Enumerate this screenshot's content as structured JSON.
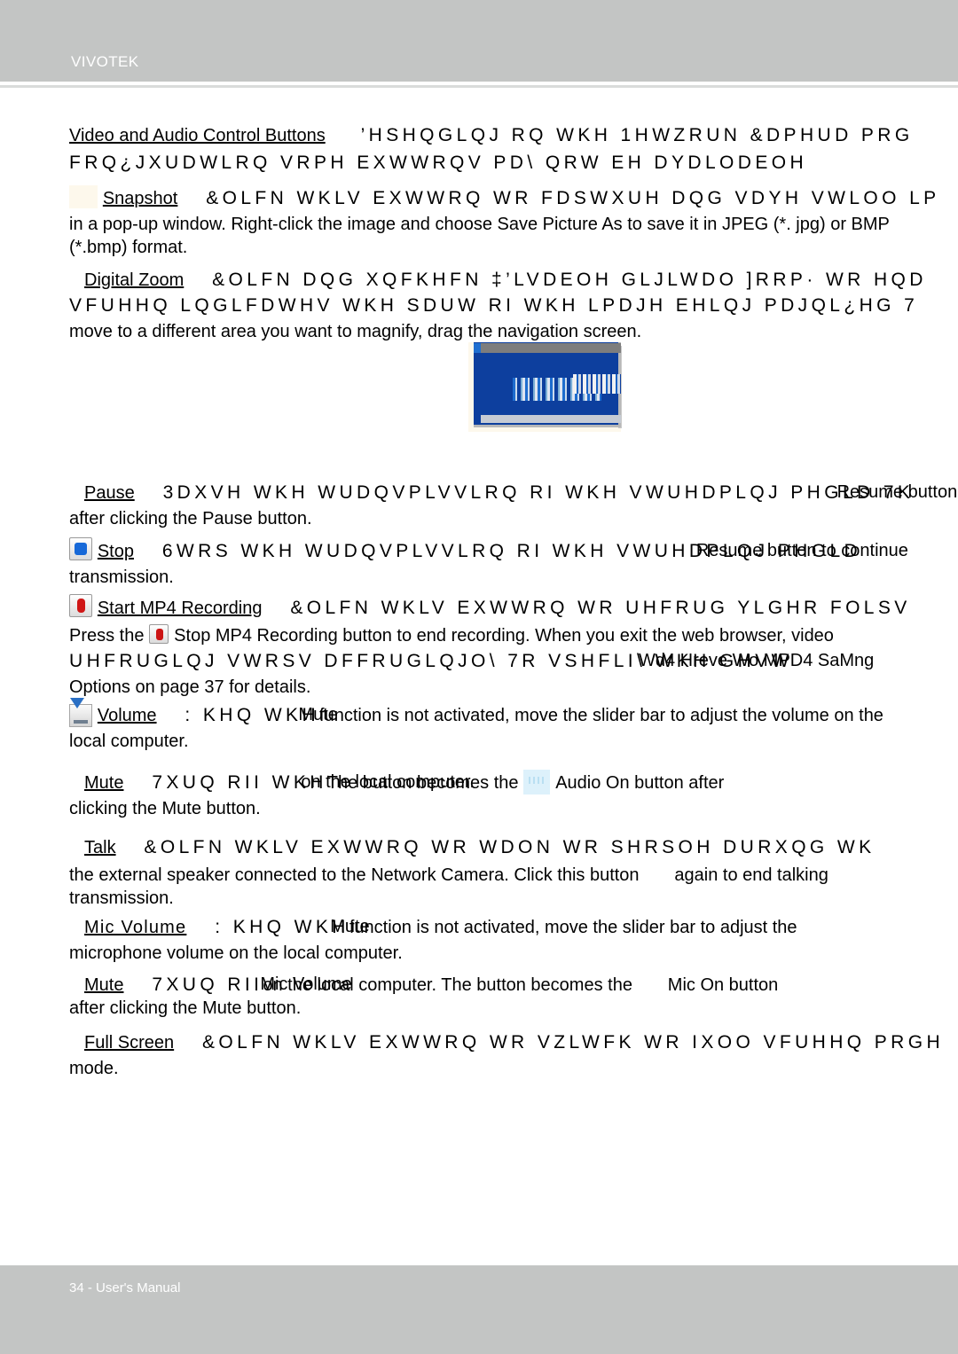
{
  "header": {
    "brand": "VIVOTEK"
  },
  "footer": {
    "page_label": "34 - User's Manual"
  },
  "colors": {
    "header_band": "#c3c5c4",
    "footer_band": "#c3c5c4",
    "page_background": "#ffffff",
    "body_text": "#000000",
    "brand_text": "#ffffff",
    "figure_window_blue": "#0d3f9e",
    "stop_icon_blue": "#1769d8",
    "record_icon_red": "#d01717",
    "audio_on_icon_blue": "#ddf1fb"
  },
  "sections": {
    "intro": {
      "label": "Video and Audio Control Buttons",
      "encoded_line1": "’HSHQGLQJ RQ WKH 1HWZRUN &DPHUD PRG",
      "encoded_line2": "FRQ¿JXUDWLRQ  VRPH EXWWRQV PD\\ QRW EH DYDLODEOH"
    },
    "snapshot": {
      "icon": "snapshot-icon",
      "label": "Snapshot",
      "encoded": "&OLFN WKLV EXWWRQ WR FDSWXUH DQG VDYH VWLOO LP",
      "plain_line2": "in a pop-up window. Right-click the image and choose Save Picture As to save it in JPEG (*. jpg) or BMP",
      "plain_line3": "(*.bmp) format."
    },
    "digital_zoom": {
      "label": "Digital Zoom",
      "encoded_line1": "&OLFN DQG XQFKHFN ‡’LVDEOH GLJLWDO ]RRP· WR HQD",
      "encoded_line2": "VFUHHQ LQGLFDWHV WKH SDUW RI WKH LPDJH EHLQJ PDJQL¿HG  7",
      "plain_line3": "move to a different area you want to magnify, drag the navigation screen."
    },
    "pause": {
      "label": "Pause",
      "encoded": "3DXVH WKH WUDQVPLVVLRQ RI WKH VWUHDPLQJ PHGLD  7K",
      "overlap_text": "Resume button",
      "plain_line2": "after clicking the Pause button."
    },
    "stop": {
      "icon": "stop-icon",
      "label": "Stop",
      "encoded": "6WRS WKH WUDQVPLVVLRQ RI WKH VWUHDPLQJ PHGLD",
      "overlap_text": "Resume button to continue",
      "plain_line2": "transmission."
    },
    "start_mp4_recording": {
      "icon": "record-icon",
      "label": "Start MP4 Recording",
      "encoded": "&OLFN WKLV EXWWRQ WR UHFRUG YLGHR FOLSV",
      "plain_line2_before_icon": "Press the",
      "inline_icon": "stop-record-icon",
      "plain_line2_after_icon": "Stop MP4 Recording button to end recording. When you exit the web browser, video",
      "encoded_line3": "UHFRUGLQJ VWRSV DFFRUGLQJO\\  7R VSHFLI\\ WKH GHVW",
      "overlap_line3": "Wd4 Hreve Wo MPD4 SaMng",
      "plain_line4": "Options on page 37 for details."
    },
    "volume": {
      "icon": "volume-icon",
      "label": "Volume",
      "encoded": ": KHQ WKH",
      "overlap_text": "Mute",
      "plain_rest": "function is not activated, move the slider bar to adjust the volume on the",
      "plain_line2": "local computer."
    },
    "mute_audio": {
      "label": "Mute",
      "encoded": "7XUQ RII WKH",
      "overlap_text": "on the local computer.",
      "plain_rest": "The button becomes the",
      "inline_icon": "audio-on-icon",
      "plain_after_icon": "Audio On button after",
      "plain_line2": "clicking the Mute button."
    },
    "talk": {
      "label": "Talk",
      "encoded": "&OLFN WKLV EXWWRQ WR WDON WR SHRSOH DURXQG WK",
      "plain_line2_a": "the external speaker connected to the Network Camera. Click this button",
      "plain_line2_b": "again to end talking",
      "plain_line3": "transmission."
    },
    "mic_volume": {
      "label": "Mic Volume",
      "encoded": ": KHQ WKH",
      "overlap_text": "Mute",
      "plain_rest": "function is not activated, move the slider bar to adjust the",
      "plain_line2": "microphone volume on the local computer."
    },
    "mute_mic": {
      "label": "Mute",
      "encoded": "7XUQ RII",
      "overlap_text": "Mic Volume",
      "plain_rest": "on the local computer. The button becomes the",
      "plain_after_icon": "Mic On button",
      "plain_line2": "after clicking the Mute button."
    },
    "full_screen": {
      "label": "Full Screen",
      "encoded": "&OLFN WKLV EXWWRQ WR VZLWFK WR IXOO VFUHHQ PRGH",
      "plain_line2": "mode."
    }
  }
}
